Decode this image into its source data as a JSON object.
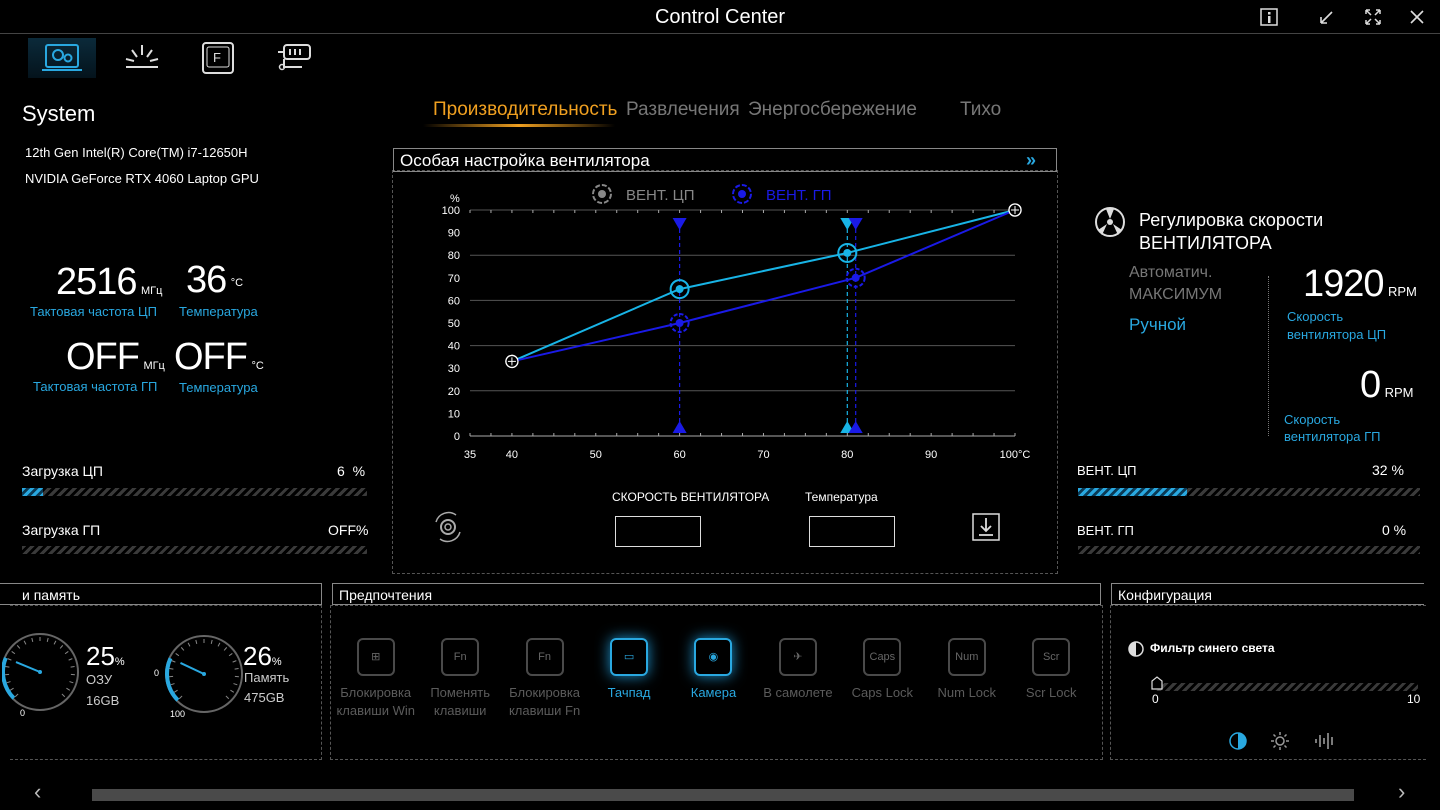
{
  "window": {
    "title": "Control Center"
  },
  "nav": [
    {
      "name": "system-tab-icon",
      "active": true
    },
    {
      "name": "lighting-tab-icon",
      "active": false
    },
    {
      "name": "keyboard-tab-icon",
      "active": false
    },
    {
      "name": "power-tab-icon",
      "active": false
    }
  ],
  "system": {
    "heading": "System",
    "cpu_name": "12th Gen Intel(R) Core(TM) i7-12650H",
    "gpu_name": "NVIDIA GeForce RTX 4060 Laptop GPU",
    "cpu_clock": "2516",
    "cpu_clock_unit": "МГц",
    "cpu_clock_label": "Тактовая частота ЦП",
    "cpu_temp": "36",
    "cpu_temp_unit": "°C",
    "cpu_temp_label": "Температура",
    "gpu_clock": "OFF",
    "gpu_clock_unit": "МГц",
    "gpu_clock_label": "Тактовая частота ГП",
    "gpu_temp": "OFF",
    "gpu_temp_unit": "°C",
    "gpu_temp_label": "Температура",
    "cpu_load_label": "Загрузка ЦП",
    "cpu_load_value": "6",
    "cpu_load_unit": "%",
    "cpu_load_fraction": 0.06,
    "gpu_load_label": "Загрузка ГП",
    "gpu_load_value": "OFF",
    "gpu_load_unit": "%",
    "gpu_load_fraction": 0
  },
  "modes": {
    "tabs": [
      "Производительность",
      "Развлечения",
      "Энергосбережение",
      "Тихо"
    ],
    "active": "Производительность"
  },
  "fan_panel": {
    "title": "Особая настройка вентилятора",
    "legend_cpu": "ВЕНТ. ЦП",
    "legend_gpu": "ВЕНТ. ГП",
    "speed_label": "СКОРОСТЬ ВЕНТИЛЯТОРА",
    "temp_label": "Температура",
    "speed_value": "",
    "temp_value": ""
  },
  "chart_data": {
    "type": "line",
    "ylabel": "%",
    "xlabel": "",
    "x_unit": "°C",
    "xlim": [
      35,
      100
    ],
    "ylim": [
      0,
      100
    ],
    "x_ticks": [
      "35",
      "40",
      "50",
      "60",
      "70",
      "80",
      "90",
      "100°C"
    ],
    "x_tick_values": [
      35,
      40,
      50,
      60,
      70,
      80,
      90,
      100
    ],
    "y_ticks": [
      0,
      10,
      20,
      30,
      40,
      50,
      60,
      70,
      80,
      90,
      100
    ],
    "series": [
      {
        "name": "ВЕНТ. ЦП",
        "color": "#18b4e6",
        "x": [
          40,
          60,
          80,
          100
        ],
        "y": [
          33,
          65,
          81,
          100
        ]
      },
      {
        "name": "ВЕНТ. ГП",
        "color": "#1a1ae6",
        "x": [
          40,
          60,
          81,
          100
        ],
        "y": [
          33,
          50,
          70,
          100
        ]
      }
    ],
    "markers": [
      {
        "x": 60,
        "color": "#1a1ae6"
      },
      {
        "x": 80,
        "color": "#18b4e6"
      },
      {
        "x": 81,
        "color": "#1a1ae6"
      }
    ],
    "grid": true
  },
  "fan_speed": {
    "title_line1": "Регулировка скорости",
    "title_line2": "ВЕНТИЛЯТОРА",
    "mode_auto": "Автоматич.",
    "mode_max": "МАКСИМУМ",
    "mode_manual": "Ручной",
    "cpu_rpm": "1920",
    "cpu_rpm_unit": "RPM",
    "cpu_rpm_label_1": "Скорость",
    "cpu_rpm_label_2": "вентилятора ЦП",
    "gpu_rpm": "0",
    "gpu_rpm_unit": "RPM",
    "gpu_rpm_label_1": "Скорость",
    "gpu_rpm_label_2": "вентилятора ГП",
    "cpu_fan_label": "ВЕНТ. ЦП",
    "cpu_fan_value": "32 %",
    "cpu_fan_fraction": 0.32,
    "gpu_fan_label": "ВЕНТ. ГП",
    "gpu_fan_value": "0 %",
    "gpu_fan_fraction": 0
  },
  "memory": {
    "title": "и память",
    "ram_percent": "25",
    "ram_percent_unit": "%",
    "ram_label": "ОЗУ",
    "ram_size": "16GB",
    "ram_fraction": 0.25,
    "disk_percent": "26",
    "disk_percent_unit": "%",
    "disk_label": "Память",
    "disk_size": "475GB",
    "disk_fraction": 0.26,
    "gauge_min": "0",
    "gauge_max": "100"
  },
  "prefs": {
    "title": "Предпочтения",
    "items": [
      {
        "l1": "Блокировка",
        "l2": "клавиши Win",
        "icon": "win-lock-icon",
        "glyph": "⊞",
        "on": false
      },
      {
        "l1": "Поменять",
        "l2": "клавиши",
        "icon": "swap-keys-icon",
        "glyph": "Fn",
        "on": false
      },
      {
        "l1": "Блокировка",
        "l2": "клавиши Fn",
        "icon": "fn-lock-icon",
        "glyph": "Fn",
        "on": false
      },
      {
        "l1": "Тачпад",
        "l2": "",
        "icon": "touchpad-icon",
        "glyph": "▭",
        "on": true
      },
      {
        "l1": "Камера",
        "l2": "",
        "icon": "camera-icon",
        "glyph": "◉",
        "on": true
      },
      {
        "l1": "В самолете",
        "l2": "",
        "icon": "airplane-icon",
        "glyph": "✈",
        "on": false
      },
      {
        "l1": "Caps Lock",
        "l2": "",
        "icon": "caps-lock-icon",
        "glyph": "Caps",
        "on": false
      },
      {
        "l1": "Num Lock",
        "l2": "",
        "icon": "num-lock-icon",
        "glyph": "Num",
        "on": false
      },
      {
        "l1": "Scr Lock",
        "l2": "",
        "icon": "scroll-lock-icon",
        "glyph": "Scr",
        "on": false
      }
    ]
  },
  "config": {
    "title": "Конфигурация",
    "blue_filter_label": "Фильтр синего света",
    "slider_min": "0",
    "slider_max": "10",
    "slider_value": 0
  }
}
